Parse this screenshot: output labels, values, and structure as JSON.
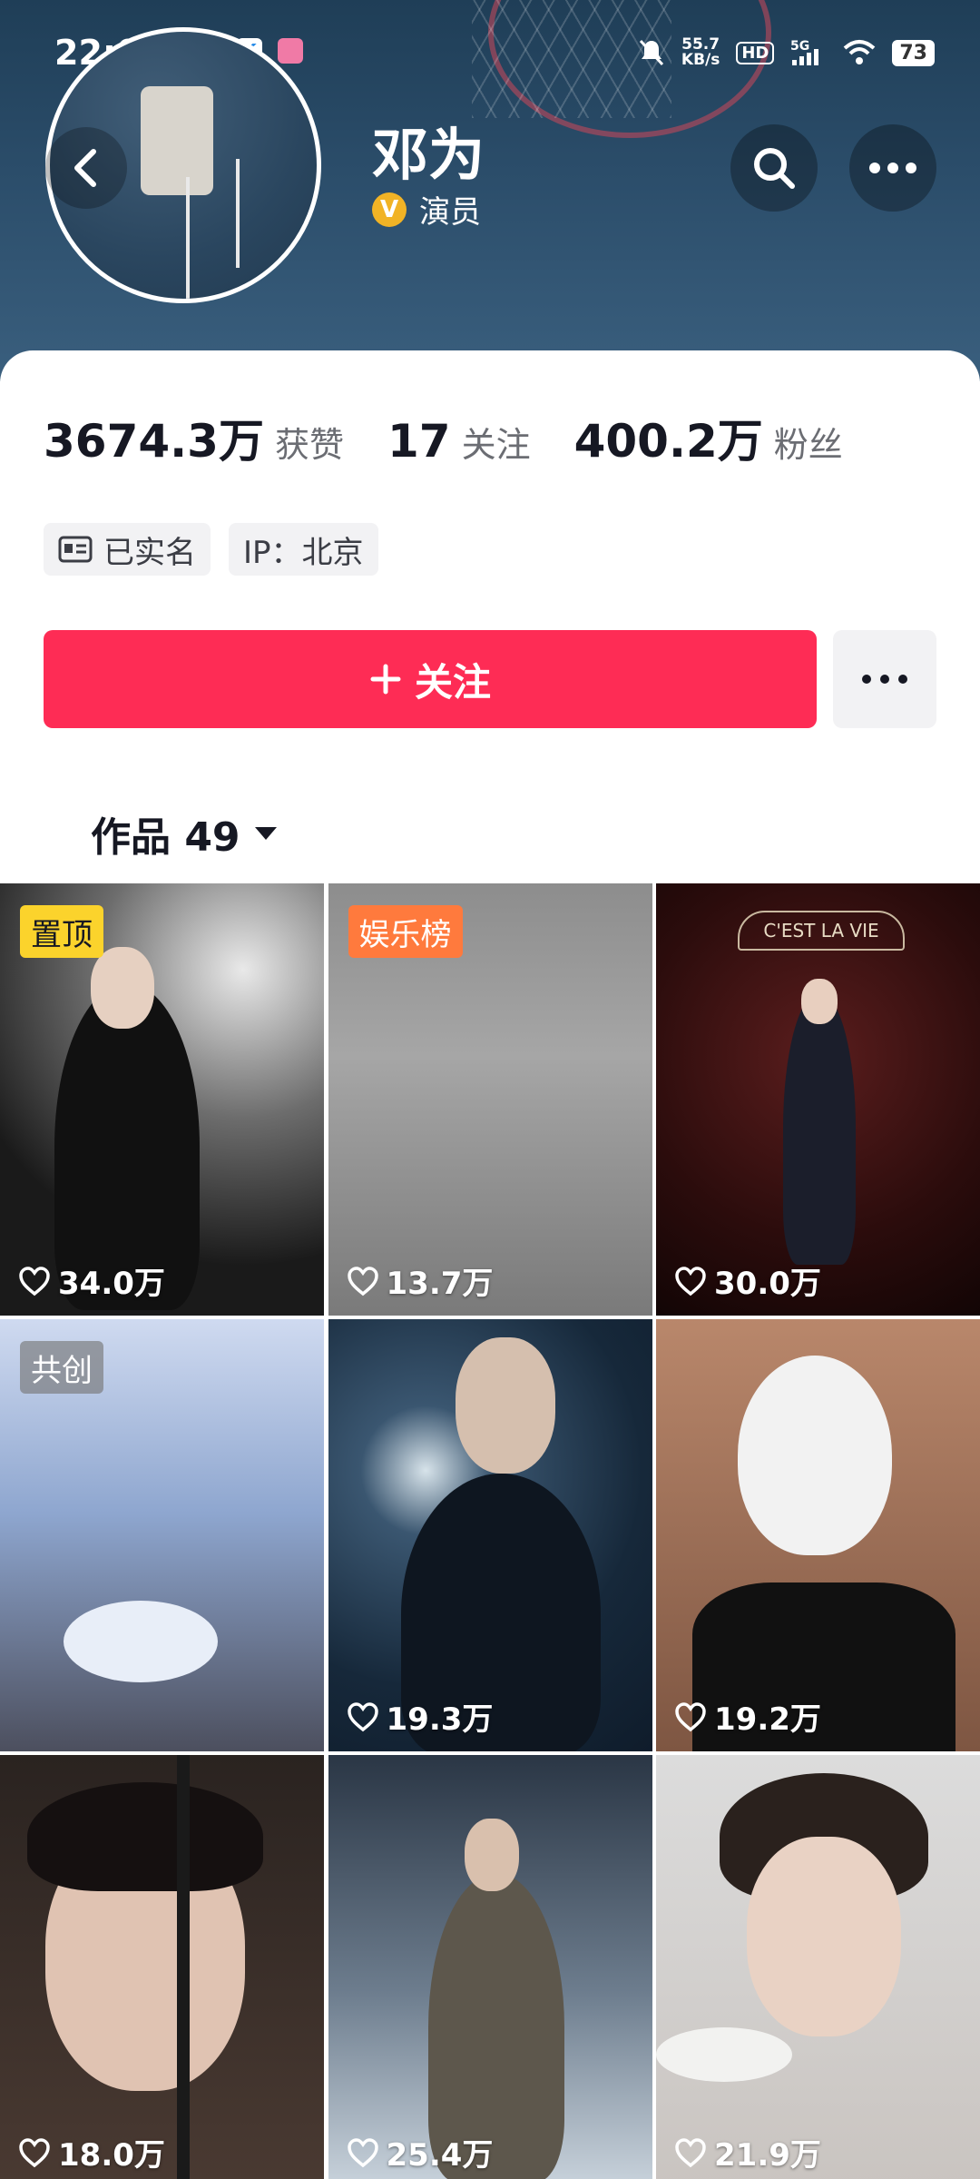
{
  "status_bar": {
    "time": "22:05",
    "speed_value": "55.7",
    "speed_unit": "KB/s",
    "hd": "HD",
    "network": "5G",
    "battery": "73"
  },
  "profile": {
    "name": "邓为",
    "verified_title": "演员",
    "verified_badge": "V"
  },
  "stats": [
    {
      "value": "3674.3万",
      "label": "获赞"
    },
    {
      "value": "17",
      "label": "关注"
    },
    {
      "value": "400.2万",
      "label": "粉丝"
    }
  ],
  "tags": {
    "realname": "已实名",
    "ip": "IP：北京"
  },
  "follow_button": {
    "label": "关注"
  },
  "works_tab": {
    "label": "作品 49"
  },
  "grid": [
    {
      "badge": "置顶",
      "likes": "34.0万"
    },
    {
      "badge": "娱乐榜",
      "likes": "13.7万"
    },
    {
      "badge": "",
      "likes": "30.0万",
      "sign": "C'EST LA VIE"
    },
    {
      "badge": "共创",
      "likes": ""
    },
    {
      "badge": "",
      "likes": "19.3万"
    },
    {
      "badge": "",
      "likes": "19.2万"
    },
    {
      "badge": "",
      "likes": "18.0万"
    },
    {
      "badge": "",
      "likes": "25.4万"
    },
    {
      "badge": "",
      "likes": "21.9万"
    }
  ],
  "colors": {
    "accent": "#fe2c55",
    "badge_pin": "#fbd32c",
    "badge_rank": "#ff7a3d"
  }
}
